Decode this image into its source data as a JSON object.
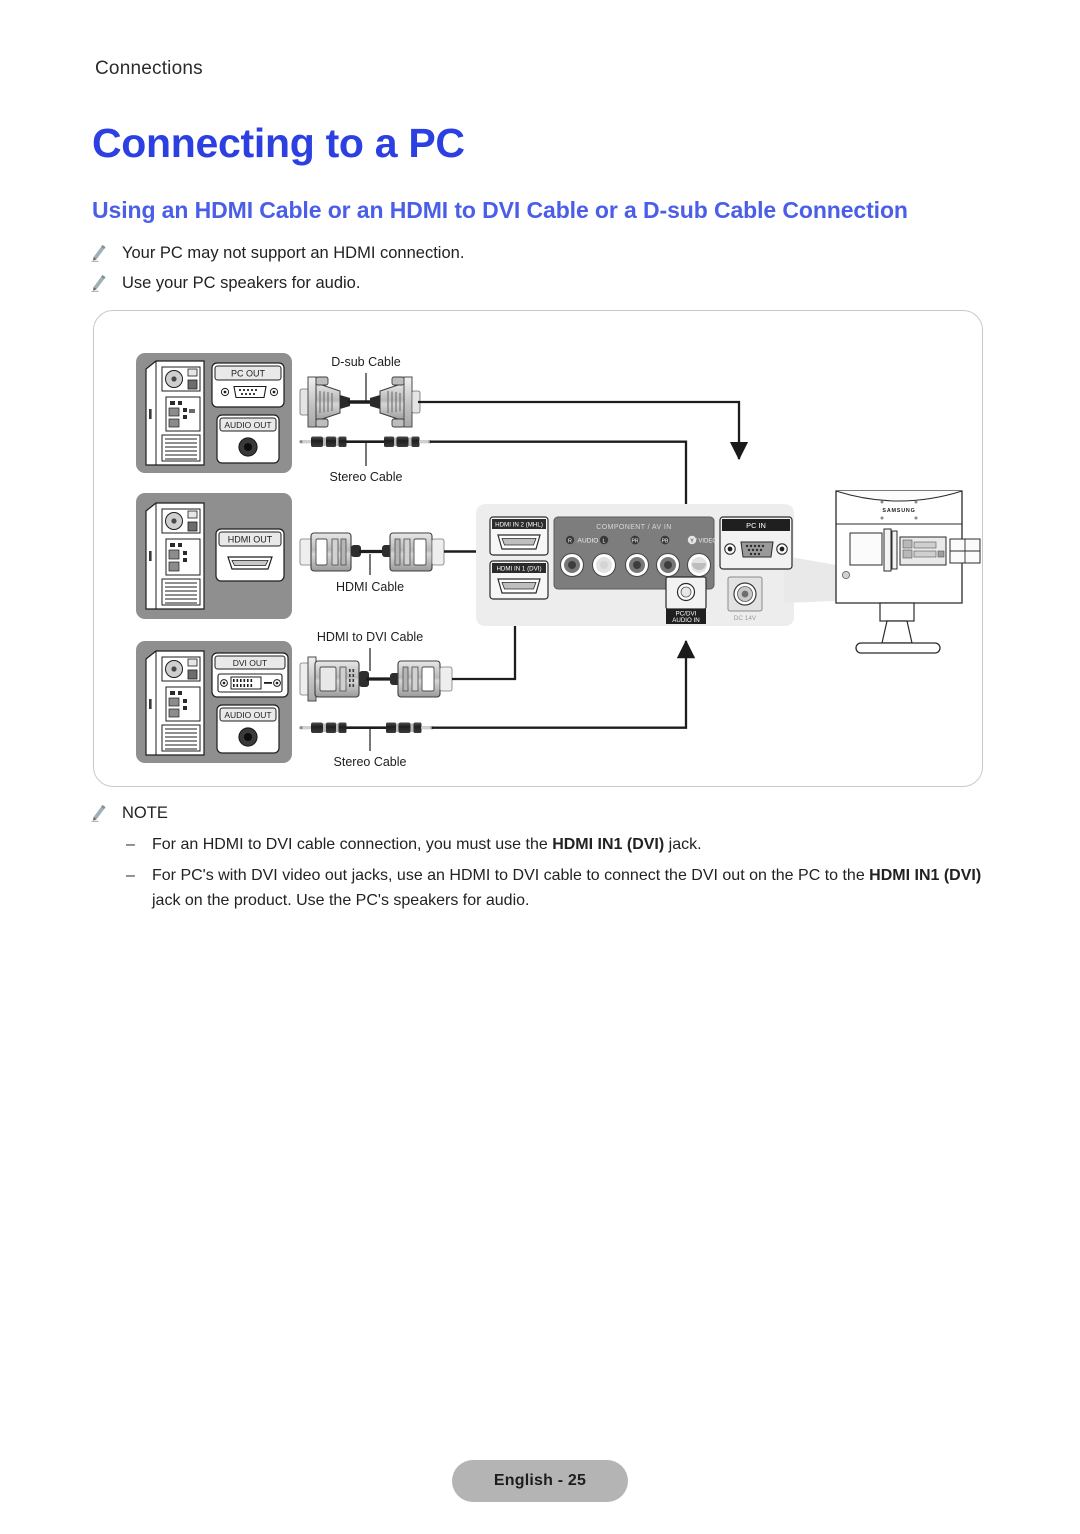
{
  "breadcrumb": "Connections",
  "title": "Connecting to a PC",
  "subtitle": "Using an HDMI Cable or an HDMI to DVI Cable or a D-sub Cable Connection",
  "colors": {
    "title_blue": "#2c3fe0",
    "subtitle_blue": "#4a5ee8",
    "panel_gray": "#8c8c8c",
    "footer_gray": "#b4b4b4"
  },
  "bullets": [
    "Your PC may not support an HDMI connection.",
    "Use your PC speakers for audio."
  ],
  "note": {
    "label": "NOTE",
    "dash": "–",
    "items": [
      {
        "parts": [
          {
            "text": "For an HDMI to DVI cable connection, you must use the ",
            "bold": false
          },
          {
            "text": "HDMI IN1 (DVI)",
            "bold": true
          },
          {
            "text": " jack.",
            "bold": false
          }
        ]
      },
      {
        "parts": [
          {
            "text": "For PC's with DVI video out jacks, use an HDMI to DVI cable to connect the DVI out on the PC to the ",
            "bold": false
          },
          {
            "text": "HDMI IN1",
            "bold": true
          },
          {
            "text": " (DVI)",
            "bold": true
          },
          {
            "text": " jack on the product. Use the PC's speakers for audio.",
            "bold": false
          }
        ]
      }
    ]
  },
  "diagram": {
    "pc_boxes": [
      {
        "id": "pc-dsub",
        "ports": [
          "PC OUT",
          "AUDIO OUT"
        ]
      },
      {
        "id": "pc-hdmi",
        "ports": [
          "HDMI OUT"
        ]
      },
      {
        "id": "pc-dvi",
        "ports": [
          "DVI OUT",
          "AUDIO OUT"
        ]
      }
    ],
    "cable_labels": [
      {
        "id": "dsub",
        "text": "D-sub Cable",
        "position": "above"
      },
      {
        "id": "stereo-top",
        "text": "Stereo Cable",
        "position": "below"
      },
      {
        "id": "hdmi",
        "text": "HDMI Cable",
        "position": "below"
      },
      {
        "id": "hdmi-dvi",
        "text": "HDMI to DVI Cable",
        "position": "above"
      },
      {
        "id": "stereo-bottom",
        "text": "Stereo Cable",
        "position": "below"
      }
    ],
    "tv_panel": {
      "hdmi2": "HDMI IN 2 (MHL)",
      "hdmi1": "HDMI IN 1 (DVI)",
      "component_title": "COMPONENT / AV IN",
      "component_jacks": [
        "R",
        "AUDIO",
        "L",
        "PR",
        "PB",
        "Y / VIDEO"
      ],
      "pc_in": "PC IN",
      "pc_dvi_audio_in": "PC/DVI\nAUDIO IN",
      "pc_dvi_audio_line1": "PC/DVI",
      "pc_dvi_audio_line2": "AUDIO IN",
      "dc_in": "DC 14V"
    },
    "monitor": {
      "brand": "SAMSUNG"
    }
  },
  "footer": {
    "page_label": "English - 25"
  }
}
